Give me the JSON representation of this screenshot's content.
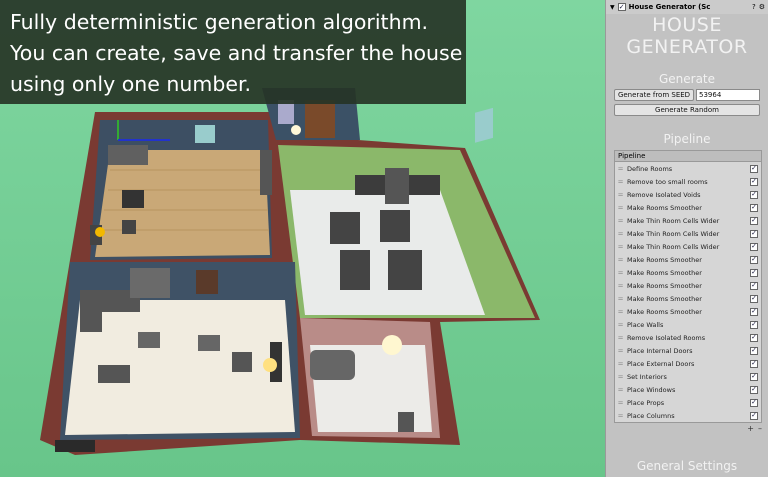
{
  "caption": {
    "lines": [
      "Fully deterministic generation algorithm.",
      "You can create, save and transfer the house",
      "using only one number."
    ]
  },
  "inspector": {
    "component_title": "House Generator (Sc",
    "header_title_line1": "HOUSE",
    "header_title_line2": "GENERATOR",
    "generate_section": "Generate",
    "generate_from_seed_label": "Generate from SEED",
    "seed_value": "53964",
    "generate_random_label": "Generate Random",
    "pipeline_section": "Pipeline",
    "pipeline_list_header": "Pipeline",
    "pipeline_steps": [
      "Define Rooms",
      "Remove too small rooms",
      "Remove Isolated Voids",
      "Make Rooms Smoother",
      "Make Thin Room Cells Wider",
      "Make Thin Room Cells Wider",
      "Make Thin Room Cells Wider",
      "Make Rooms Smoother",
      "Make Rooms Smoother",
      "Make Rooms Smoother",
      "Make Rooms Smoother",
      "Make Rooms Smoother",
      "Place Walls",
      "Remove Isolated Rooms",
      "Place Internal Doors",
      "Place External Doors",
      "Set Interiors",
      "Place Windows",
      "Place Props",
      "Place Columns"
    ],
    "add_remove": "+ -",
    "general_settings_section": "General Settings"
  },
  "colors": {
    "ground": "#6fcf94",
    "panel_bg": "#c2c2c2",
    "caption_bg": "#263426",
    "wall_red": "#7a3a32",
    "wall_blue": "#3f5266",
    "floor_wood": "#c8a97c",
    "floor_white": "#eef0ee"
  }
}
